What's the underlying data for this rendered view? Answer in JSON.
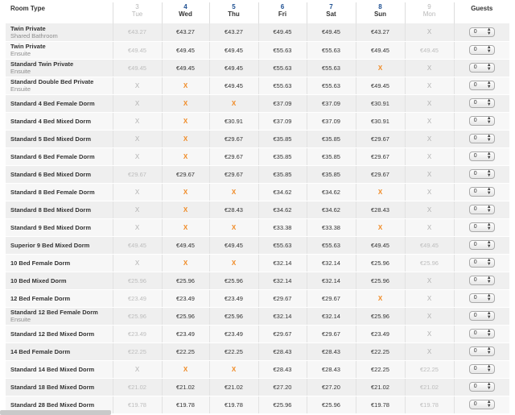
{
  "header": {
    "room_type_label": "Room Type",
    "guests_label": "Guests",
    "days": [
      {
        "num": "3",
        "name": "Tue",
        "state": "dim"
      },
      {
        "num": "4",
        "name": "Wed",
        "state": "active"
      },
      {
        "num": "5",
        "name": "Thu",
        "state": "active"
      },
      {
        "num": "6",
        "name": "Fri",
        "state": "active"
      },
      {
        "num": "7",
        "name": "Sat",
        "state": "active"
      },
      {
        "num": "8",
        "name": "Sun",
        "state": "active"
      },
      {
        "num": "9",
        "name": "Mon",
        "state": "dim"
      }
    ]
  },
  "guest_select_value": "0",
  "rows": [
    {
      "name": "Twin Private",
      "sub": "Shared Bathroom",
      "cells": [
        {
          "t": "€43.27",
          "s": "dim"
        },
        {
          "t": "€43.27",
          "s": "p"
        },
        {
          "t": "€43.27",
          "s": "p"
        },
        {
          "t": "€49.45",
          "s": "p"
        },
        {
          "t": "€49.45",
          "s": "p"
        },
        {
          "t": "€43.27",
          "s": "p"
        },
        {
          "t": "X",
          "s": "xg"
        }
      ]
    },
    {
      "name": "Twin Private",
      "sub": "Ensuite",
      "cells": [
        {
          "t": "€49.45",
          "s": "dim"
        },
        {
          "t": "€49.45",
          "s": "p"
        },
        {
          "t": "€49.45",
          "s": "p"
        },
        {
          "t": "€55.63",
          "s": "p"
        },
        {
          "t": "€55.63",
          "s": "p"
        },
        {
          "t": "€49.45",
          "s": "p"
        },
        {
          "t": "€49.45",
          "s": "dim"
        }
      ]
    },
    {
      "name": "Standard Twin Private",
      "sub": "Ensuite",
      "cells": [
        {
          "t": "€49.45",
          "s": "dim"
        },
        {
          "t": "€49.45",
          "s": "p"
        },
        {
          "t": "€49.45",
          "s": "p"
        },
        {
          "t": "€55.63",
          "s": "p"
        },
        {
          "t": "€55.63",
          "s": "p"
        },
        {
          "t": "X",
          "s": "xo"
        },
        {
          "t": "X",
          "s": "xg"
        }
      ]
    },
    {
      "name": "Standard Double Bed Private",
      "sub": "Ensuite",
      "cells": [
        {
          "t": "X",
          "s": "xg"
        },
        {
          "t": "X",
          "s": "xo"
        },
        {
          "t": "€49.45",
          "s": "p"
        },
        {
          "t": "€55.63",
          "s": "p"
        },
        {
          "t": "€55.63",
          "s": "p"
        },
        {
          "t": "€49.45",
          "s": "p"
        },
        {
          "t": "X",
          "s": "xg"
        }
      ]
    },
    {
      "name": "Standard 4 Bed Female Dorm",
      "sub": "",
      "cells": [
        {
          "t": "X",
          "s": "xg"
        },
        {
          "t": "X",
          "s": "xo"
        },
        {
          "t": "X",
          "s": "xo"
        },
        {
          "t": "€37.09",
          "s": "p"
        },
        {
          "t": "€37.09",
          "s": "p"
        },
        {
          "t": "€30.91",
          "s": "p"
        },
        {
          "t": "X",
          "s": "xg"
        }
      ]
    },
    {
      "name": "Standard 4 Bed Mixed Dorm",
      "sub": "",
      "cells": [
        {
          "t": "X",
          "s": "xg"
        },
        {
          "t": "X",
          "s": "xo"
        },
        {
          "t": "€30.91",
          "s": "p"
        },
        {
          "t": "€37.09",
          "s": "p"
        },
        {
          "t": "€37.09",
          "s": "p"
        },
        {
          "t": "€30.91",
          "s": "p"
        },
        {
          "t": "X",
          "s": "xg"
        }
      ]
    },
    {
      "name": "Standard 5 Bed Mixed Dorm",
      "sub": "",
      "cells": [
        {
          "t": "X",
          "s": "xg"
        },
        {
          "t": "X",
          "s": "xo"
        },
        {
          "t": "€29.67",
          "s": "p"
        },
        {
          "t": "€35.85",
          "s": "p"
        },
        {
          "t": "€35.85",
          "s": "p"
        },
        {
          "t": "€29.67",
          "s": "p"
        },
        {
          "t": "X",
          "s": "xg"
        }
      ]
    },
    {
      "name": "Standard 6 Bed Female Dorm",
      "sub": "",
      "cells": [
        {
          "t": "X",
          "s": "xg"
        },
        {
          "t": "X",
          "s": "xo"
        },
        {
          "t": "€29.67",
          "s": "p"
        },
        {
          "t": "€35.85",
          "s": "p"
        },
        {
          "t": "€35.85",
          "s": "p"
        },
        {
          "t": "€29.67",
          "s": "p"
        },
        {
          "t": "X",
          "s": "xg"
        }
      ]
    },
    {
      "name": "Standard 6 Bed Mixed Dorm",
      "sub": "",
      "cells": [
        {
          "t": "€29.67",
          "s": "dim"
        },
        {
          "t": "€29.67",
          "s": "p"
        },
        {
          "t": "€29.67",
          "s": "p"
        },
        {
          "t": "€35.85",
          "s": "p"
        },
        {
          "t": "€35.85",
          "s": "p"
        },
        {
          "t": "€29.67",
          "s": "p"
        },
        {
          "t": "X",
          "s": "xg"
        }
      ]
    },
    {
      "name": "Standard 8 Bed Female Dorm",
      "sub": "",
      "cells": [
        {
          "t": "X",
          "s": "xg"
        },
        {
          "t": "X",
          "s": "xo"
        },
        {
          "t": "X",
          "s": "xo"
        },
        {
          "t": "€34.62",
          "s": "p"
        },
        {
          "t": "€34.62",
          "s": "p"
        },
        {
          "t": "X",
          "s": "xo"
        },
        {
          "t": "X",
          "s": "xg"
        }
      ]
    },
    {
      "name": "Standard 8 Bed Mixed Dorm",
      "sub": "",
      "cells": [
        {
          "t": "X",
          "s": "xg"
        },
        {
          "t": "X",
          "s": "xo"
        },
        {
          "t": "€28.43",
          "s": "p"
        },
        {
          "t": "€34.62",
          "s": "p"
        },
        {
          "t": "€34.62",
          "s": "p"
        },
        {
          "t": "€28.43",
          "s": "p"
        },
        {
          "t": "X",
          "s": "xg"
        }
      ]
    },
    {
      "name": "Standard 9 Bed Mixed Dorm",
      "sub": "",
      "cells": [
        {
          "t": "X",
          "s": "xg"
        },
        {
          "t": "X",
          "s": "xo"
        },
        {
          "t": "X",
          "s": "xo"
        },
        {
          "t": "€33.38",
          "s": "p"
        },
        {
          "t": "€33.38",
          "s": "p"
        },
        {
          "t": "X",
          "s": "xo"
        },
        {
          "t": "X",
          "s": "xg"
        }
      ]
    },
    {
      "name": "Superior 9 Bed Mixed Dorm",
      "sub": "",
      "cells": [
        {
          "t": "€49.45",
          "s": "dim"
        },
        {
          "t": "€49.45",
          "s": "p"
        },
        {
          "t": "€49.45",
          "s": "p"
        },
        {
          "t": "€55.63",
          "s": "p"
        },
        {
          "t": "€55.63",
          "s": "p"
        },
        {
          "t": "€49.45",
          "s": "p"
        },
        {
          "t": "€49.45",
          "s": "dim"
        }
      ]
    },
    {
      "name": "10 Bed Female Dorm",
      "sub": "",
      "cells": [
        {
          "t": "X",
          "s": "xg"
        },
        {
          "t": "X",
          "s": "xo"
        },
        {
          "t": "X",
          "s": "xo"
        },
        {
          "t": "€32.14",
          "s": "p"
        },
        {
          "t": "€32.14",
          "s": "p"
        },
        {
          "t": "€25.96",
          "s": "p"
        },
        {
          "t": "€25.96",
          "s": "dim"
        }
      ]
    },
    {
      "name": "10 Bed Mixed Dorm",
      "sub": "",
      "cells": [
        {
          "t": "€25.96",
          "s": "dim"
        },
        {
          "t": "€25.96",
          "s": "p"
        },
        {
          "t": "€25.96",
          "s": "p"
        },
        {
          "t": "€32.14",
          "s": "p"
        },
        {
          "t": "€32.14",
          "s": "p"
        },
        {
          "t": "€25.96",
          "s": "p"
        },
        {
          "t": "X",
          "s": "xg"
        }
      ]
    },
    {
      "name": "12 Bed Female Dorm",
      "sub": "",
      "cells": [
        {
          "t": "€23.49",
          "s": "dim"
        },
        {
          "t": "€23.49",
          "s": "p"
        },
        {
          "t": "€23.49",
          "s": "p"
        },
        {
          "t": "€29.67",
          "s": "p"
        },
        {
          "t": "€29.67",
          "s": "p"
        },
        {
          "t": "X",
          "s": "xo"
        },
        {
          "t": "X",
          "s": "xg"
        }
      ]
    },
    {
      "name": "Standard 12 Bed Female Dorm",
      "sub": "Ensuite",
      "cells": [
        {
          "t": "€25.96",
          "s": "dim"
        },
        {
          "t": "€25.96",
          "s": "p"
        },
        {
          "t": "€25.96",
          "s": "p"
        },
        {
          "t": "€32.14",
          "s": "p"
        },
        {
          "t": "€32.14",
          "s": "p"
        },
        {
          "t": "€25.96",
          "s": "p"
        },
        {
          "t": "X",
          "s": "xg"
        }
      ]
    },
    {
      "name": "Standard 12 Bed Mixed Dorm",
      "sub": "",
      "cells": [
        {
          "t": "€23.49",
          "s": "dim"
        },
        {
          "t": "€23.49",
          "s": "p"
        },
        {
          "t": "€23.49",
          "s": "p"
        },
        {
          "t": "€29.67",
          "s": "p"
        },
        {
          "t": "€29.67",
          "s": "p"
        },
        {
          "t": "€23.49",
          "s": "p"
        },
        {
          "t": "X",
          "s": "xg"
        }
      ]
    },
    {
      "name": "14 Bed Female Dorm",
      "sub": "",
      "cells": [
        {
          "t": "€22.25",
          "s": "dim"
        },
        {
          "t": "€22.25",
          "s": "p"
        },
        {
          "t": "€22.25",
          "s": "p"
        },
        {
          "t": "€28.43",
          "s": "p"
        },
        {
          "t": "€28.43",
          "s": "p"
        },
        {
          "t": "€22.25",
          "s": "p"
        },
        {
          "t": "X",
          "s": "xg"
        }
      ]
    },
    {
      "name": "Standard 14 Bed Mixed Dorm",
      "sub": "",
      "cells": [
        {
          "t": "X",
          "s": "xg"
        },
        {
          "t": "X",
          "s": "xo"
        },
        {
          "t": "X",
          "s": "xo"
        },
        {
          "t": "€28.43",
          "s": "p"
        },
        {
          "t": "€28.43",
          "s": "p"
        },
        {
          "t": "€22.25",
          "s": "p"
        },
        {
          "t": "€22.25",
          "s": "dim"
        }
      ]
    },
    {
      "name": "Standard 18 Bed Mixed Dorm",
      "sub": "",
      "cells": [
        {
          "t": "€21.02",
          "s": "dim"
        },
        {
          "t": "€21.02",
          "s": "p"
        },
        {
          "t": "€21.02",
          "s": "p"
        },
        {
          "t": "€27.20",
          "s": "p"
        },
        {
          "t": "€27.20",
          "s": "p"
        },
        {
          "t": "€21.02",
          "s": "p"
        },
        {
          "t": "€21.02",
          "s": "dim"
        }
      ]
    },
    {
      "name": "Standard 28 Bed Mixed Dorm",
      "sub": "",
      "cells": [
        {
          "t": "€19.78",
          "s": "dim"
        },
        {
          "t": "€19.78",
          "s": "p"
        },
        {
          "t": "€19.78",
          "s": "p"
        },
        {
          "t": "€25.96",
          "s": "p"
        },
        {
          "t": "€25.96",
          "s": "p"
        },
        {
          "t": "€19.78",
          "s": "p"
        },
        {
          "t": "€19.78",
          "s": "dim"
        }
      ]
    }
  ]
}
